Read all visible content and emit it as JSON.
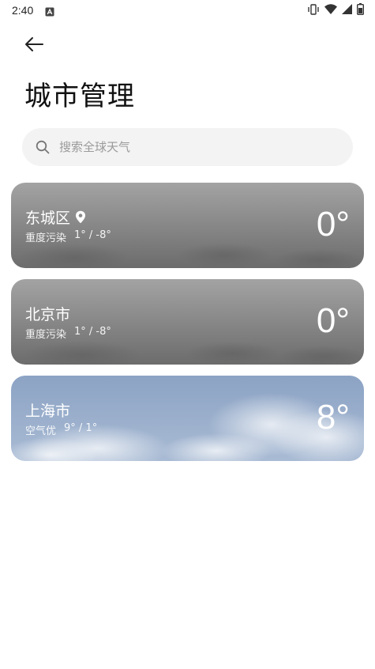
{
  "status_bar": {
    "time": "2:40",
    "icons": [
      "notification-a-icon",
      "vibrate-icon",
      "wifi-icon",
      "signal-icon",
      "battery-icon"
    ]
  },
  "header": {
    "back_icon": "arrow-left-icon",
    "title": "城市管理"
  },
  "search": {
    "icon": "search-icon",
    "placeholder": "搜索全球天气",
    "value": ""
  },
  "cities": [
    {
      "name": "东城区",
      "is_location": true,
      "aqi": "重度污染",
      "range": "1° / -8°",
      "temp": "0°",
      "theme": "haze"
    },
    {
      "name": "北京市",
      "is_location": false,
      "aqi": "重度污染",
      "range": "1° / -8°",
      "temp": "0°",
      "theme": "haze"
    },
    {
      "name": "上海市",
      "is_location": false,
      "aqi": "空气优",
      "range": "9° / 1°",
      "temp": "8°",
      "theme": "cloudy"
    }
  ],
  "colors": {
    "haze_top": "#9a9a9a",
    "haze_bottom": "#6f6f6f",
    "cloudy_top": "#8fa6c6",
    "cloudy_bottom": "#b7c6da",
    "search_bg": "#f3f3f3"
  }
}
